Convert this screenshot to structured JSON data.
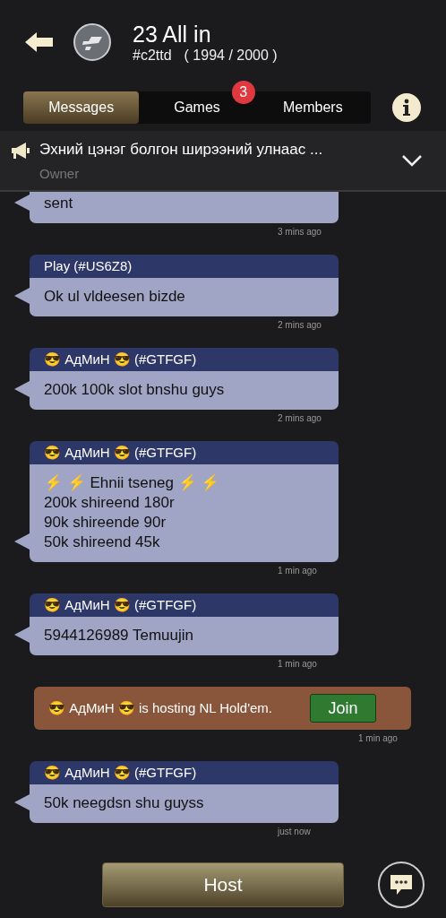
{
  "header": {
    "title": "23 All in",
    "club_id": "#c2ttd",
    "member_count": "( 1994 / 2000 )"
  },
  "tabs": [
    {
      "label": "Messages",
      "selected": true
    },
    {
      "label": "Games",
      "selected": false,
      "badge": "3"
    },
    {
      "label": "Members",
      "selected": false
    }
  ],
  "announcement": {
    "text": "Эхний цэнэг болгон ширээний улнаас ...",
    "author": "Owner"
  },
  "messages": [
    {
      "kind": "message",
      "text": "sent",
      "time": "3 mins ago"
    },
    {
      "kind": "message",
      "sender": "Play (#US6Z8)",
      "text": "Ok ul vldeesen bizde",
      "time": "2 mins ago"
    },
    {
      "kind": "message",
      "sender": "😎 АдМиН 😎 (#GTFGF)",
      "text": "200k 100k slot bnshu guys",
      "time": "2 mins ago"
    },
    {
      "kind": "message",
      "sender": "😎 АдМиН 😎 (#GTFGF)",
      "text": "⚡ ⚡ Ehnii tseneg ⚡ ⚡\n200k shireend 180r\n90k shireende 90r\n50k shireend 45k",
      "time": "1 min ago"
    },
    {
      "kind": "message",
      "sender": "😎 АдМиН 😎 (#GTFGF)",
      "text": "5944126989 Temuujin",
      "time": "1 min ago"
    },
    {
      "kind": "game_invite",
      "text": "😎 АдМиН 😎 is hosting NL Hold'em.",
      "button": "Join",
      "time": "1 min ago"
    },
    {
      "kind": "message",
      "sender": "😎 АдМиН 😎 (#GTFGF)",
      "text": "50k neegdsn shu guyss",
      "time": "just now"
    }
  ],
  "host_button": "Host"
}
